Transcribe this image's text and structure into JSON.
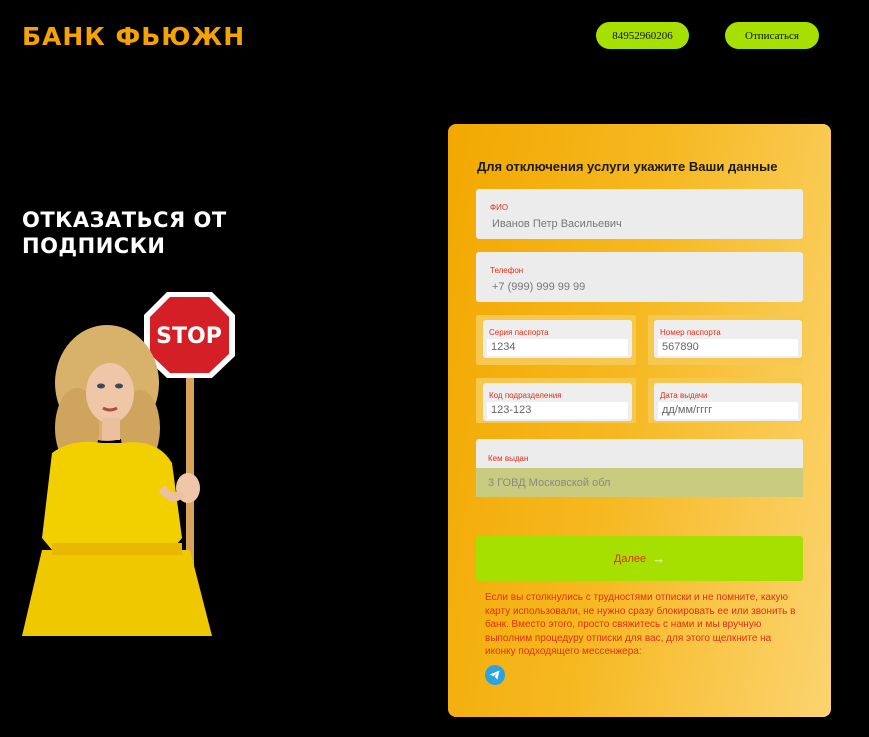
{
  "header": {
    "logo_text": "БАНК ФЬЮЖН",
    "phone_button": "84952960206",
    "unsubscribe_button": "Отписаться"
  },
  "hero": {
    "title": "ОТКАЗАТЬСЯ ОТ ПОДПИСКИ",
    "sign_text": "STOP"
  },
  "form": {
    "title": "Для отключения услуги укажите Ваши данные",
    "fio": {
      "label": "ФИО",
      "placeholder": "Иванов Петр Васильевич"
    },
    "phone": {
      "label": "Телефон",
      "placeholder": "+7 (999) 999 99 99"
    },
    "passport_series": {
      "label": "Серия паспорта",
      "placeholder": "1234"
    },
    "passport_number": {
      "label": "Номер паспорта",
      "placeholder": "567890"
    },
    "division_code": {
      "label": "Код подразделения",
      "placeholder": "123-123"
    },
    "issue_date": {
      "label": "Дата выдачи",
      "placeholder": "дд/мм/гггг"
    },
    "issued_by": {
      "label": "Кем выдан",
      "placeholder": "3 ГОВД Московской обл"
    },
    "next_button": "Далее",
    "help_text": "Если вы столкнулись с трудностями отписки и не помните, какую карту использовали, не нужно сразу блокировать ее или звонить в банк. Вместо этого, просто свяжитесь с нами и мы вручную выполним процедуру отписки для вас, для этого щелкните на иконку подходящего мессенжера:"
  },
  "icons": {
    "next": "arrow-right-icon",
    "messenger": "telegram-icon"
  },
  "colors": {
    "accent_green": "#a6e000",
    "logo_gold": "#f4a300",
    "label_red": "#e0301a"
  }
}
